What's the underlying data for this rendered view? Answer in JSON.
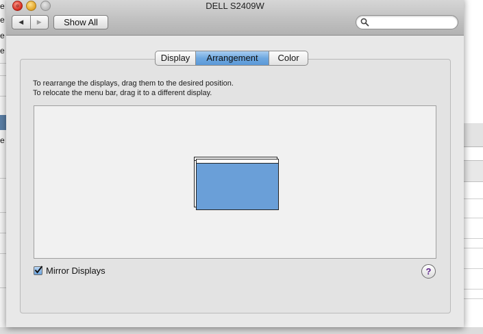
{
  "window": {
    "title": "DELL S2409W"
  },
  "toolbar": {
    "back_label": "◀",
    "forward_label": "▶",
    "show_all_label": "Show All",
    "search": {
      "value": "",
      "placeholder": ""
    }
  },
  "tabs": [
    {
      "label": "Display",
      "selected": false
    },
    {
      "label": "Arrangement",
      "selected": true
    },
    {
      "label": "Color",
      "selected": false
    }
  ],
  "instructions": {
    "line1": "To rearrange the displays, drag them to the desired position.",
    "line2": "To relocate the menu bar, drag it to a different display."
  },
  "mirror": {
    "label": "Mirror Displays",
    "checked": true
  },
  "help_label": "?",
  "background_app": {
    "fragments": [
      "e",
      "e",
      "e",
      "e",
      "e"
    ]
  },
  "colors": {
    "accent": "#6a9fd8",
    "selected_tab": "#6ea8e0"
  }
}
